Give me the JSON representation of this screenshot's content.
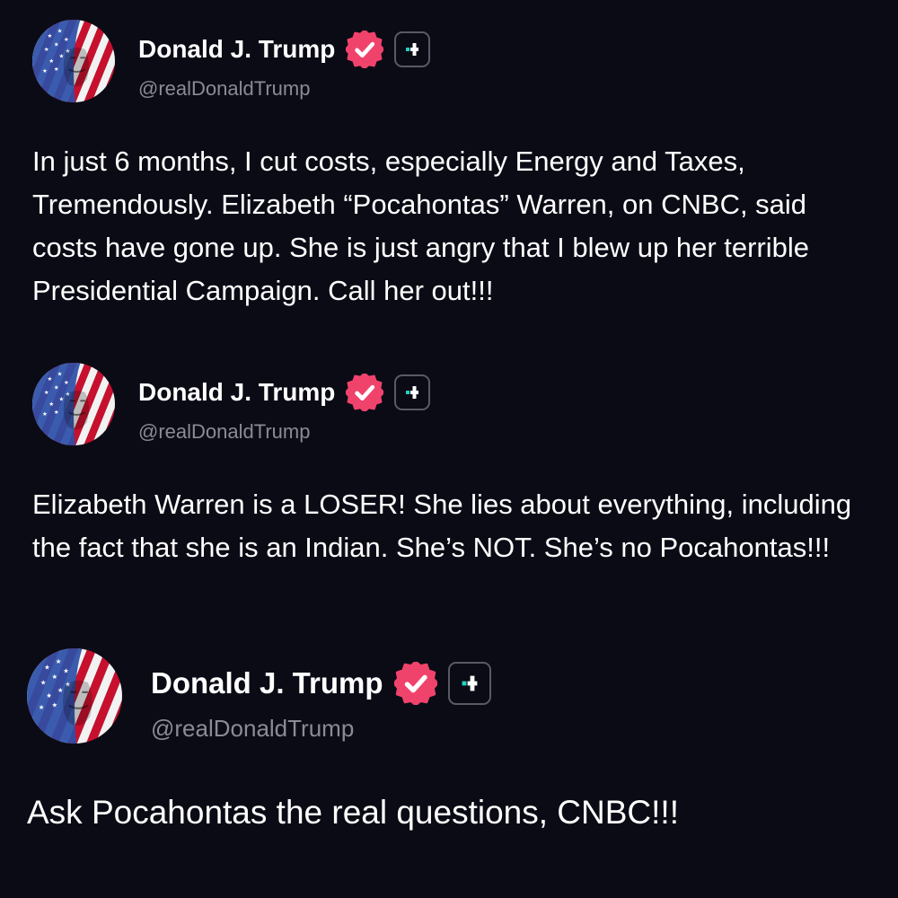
{
  "theme": {
    "background": "#0b0b16",
    "text": "#ffffff",
    "handle_color": "#8b8b96",
    "verified_color": "#f0436c",
    "plus_accent": "#22d3c5",
    "plus_border": "#5a5a66"
  },
  "posts": [
    {
      "author": {
        "display_name": "Donald J. Trump",
        "handle": "@realDonaldTrump",
        "avatar_icon": "flag-portrait-avatar",
        "verified_icon": "verified-badge-icon",
        "plus_icon": "plus-badge-icon"
      },
      "text": "In just 6 months, I cut costs, especially Energy and Taxes, Tremendously. Elizabeth “Pocahontas” Warren, on CNBC, said costs have gone up. She is just angry that I blew up her terrible Presidential Campaign. Call her out!!!"
    },
    {
      "author": {
        "display_name": "Donald J. Trump",
        "handle": "@realDonaldTrump",
        "avatar_icon": "flag-portrait-avatar",
        "verified_icon": "verified-badge-icon",
        "plus_icon": "plus-badge-icon"
      },
      "text": "Elizabeth Warren is a LOSER! She lies about everything, including the fact that she is an Indian. She’s NOT. She’s no Pocahontas!!!"
    },
    {
      "author": {
        "display_name": "Donald J. Trump",
        "handle": "@realDonaldTrump",
        "avatar_icon": "flag-portrait-avatar",
        "verified_icon": "verified-badge-icon",
        "plus_icon": "plus-badge-icon"
      },
      "text": "Ask Pocahontas the real questions, CNBC!!!"
    }
  ]
}
